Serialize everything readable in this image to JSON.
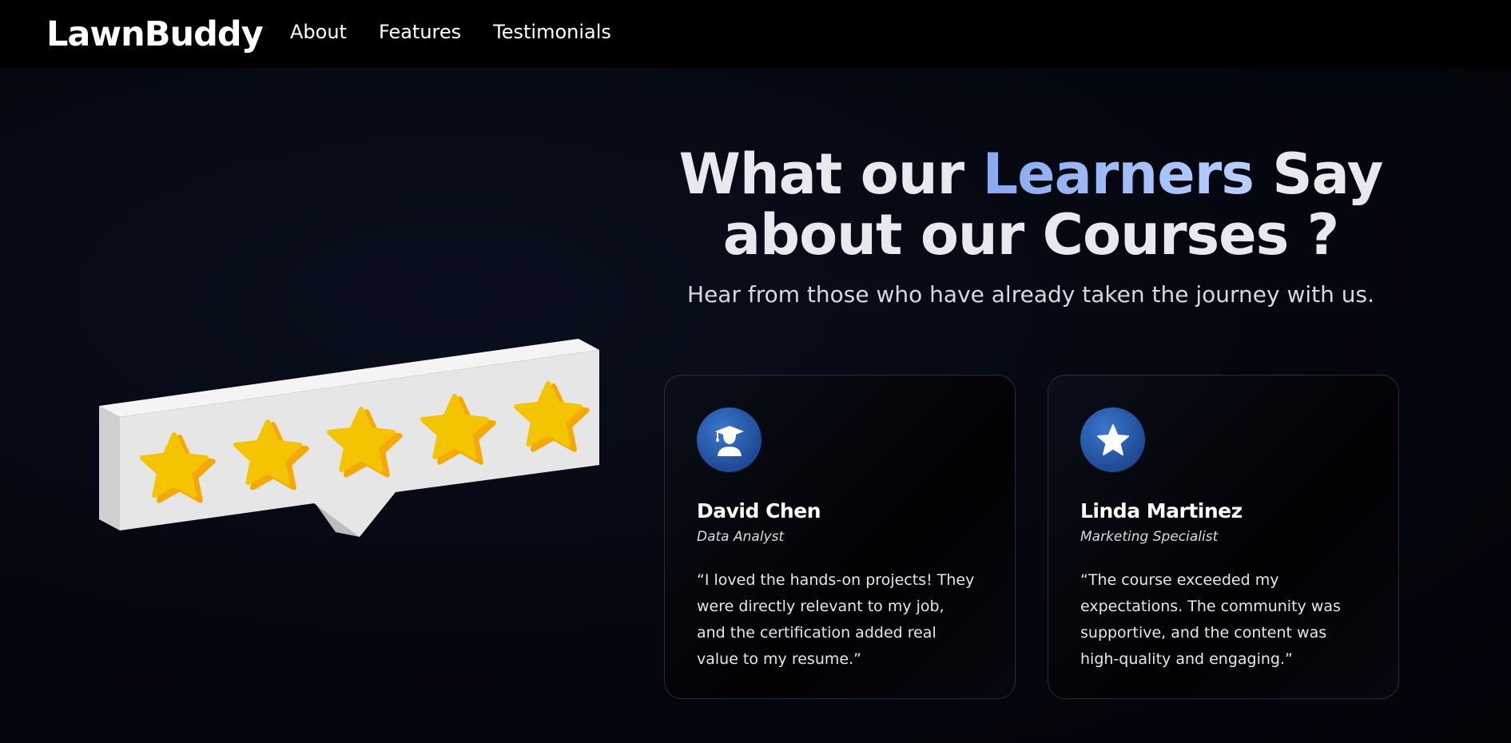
{
  "brand": {
    "name": "LawnBuddy"
  },
  "nav": {
    "items": [
      "About",
      "Features",
      "Testimonials"
    ]
  },
  "hero": {
    "title_part1": "What our ",
    "title_accent": "Learners",
    "title_part2": " Say about our Courses ?",
    "subtitle": "Hear from those who have already taken the journey with us."
  },
  "illustration": {
    "name": "five-star-rating-speech-bubble",
    "stars": 5
  },
  "testimonials": [
    {
      "icon": "graduate-icon",
      "name": "David Chen",
      "role": "Data Analyst",
      "quote": "“I loved the hands-on projects! They were directly relevant to my job, and the certification added real value to my resume.”"
    },
    {
      "icon": "star-icon",
      "name": "Linda Martinez",
      "role": "Marketing Specialist",
      "quote": "“The course exceeded my expectations. The community was supportive, and the content was high-quality and engaging.”"
    }
  ],
  "colors": {
    "background": "#05070f",
    "navbar": "#000000",
    "accent": "#9ab8f5",
    "star": "#f5c400",
    "avatar": "#2a5cae"
  }
}
